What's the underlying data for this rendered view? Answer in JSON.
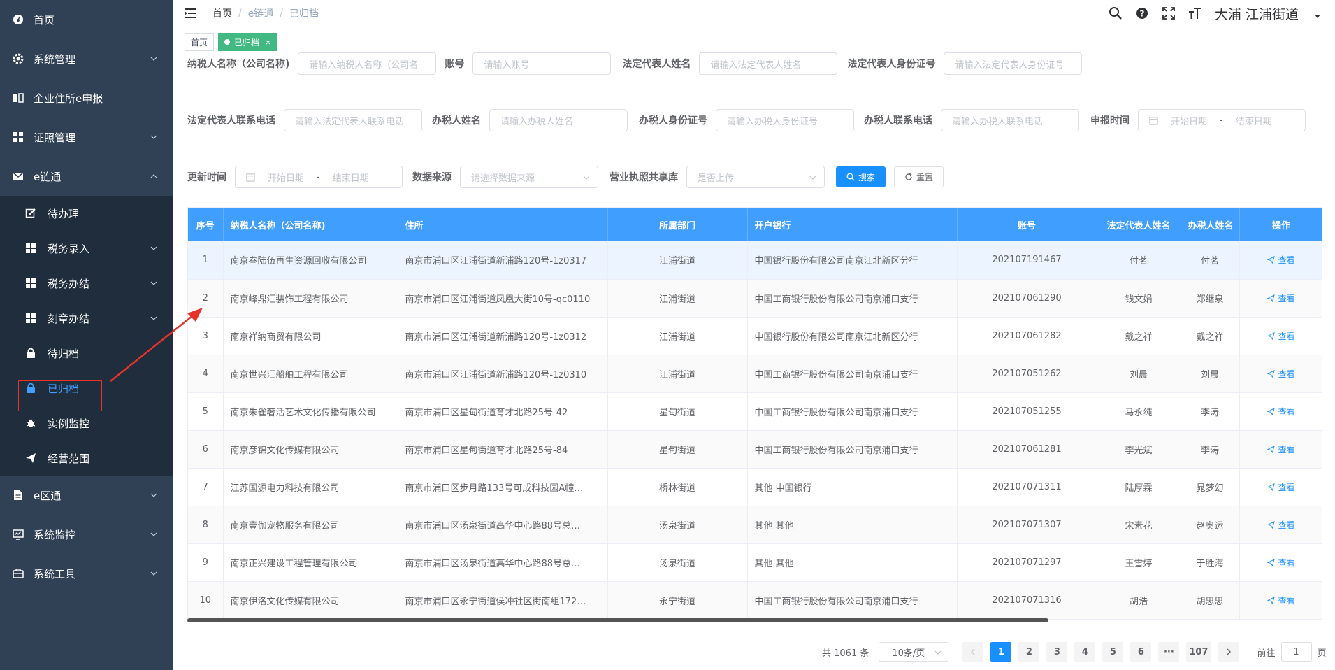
{
  "sidebar": {
    "items": [
      {
        "label": "首页",
        "icon": "dashboard-icon"
      },
      {
        "label": "系统管理",
        "icon": "gear-icon"
      },
      {
        "label": "企业住所e申报",
        "icon": "book-icon"
      },
      {
        "label": "证照管理",
        "icon": "grid-icon"
      },
      {
        "label": "e链通",
        "icon": "mail-icon"
      }
    ],
    "submenu": [
      {
        "label": "待办理",
        "icon": "edit-icon"
      },
      {
        "label": "税务录入",
        "icon": "grid-icon"
      },
      {
        "label": "税务办结",
        "icon": "grid-icon"
      },
      {
        "label": "刻章办结",
        "icon": "grid-icon"
      },
      {
        "label": "待归档",
        "icon": "lock-icon"
      },
      {
        "label": "已归档",
        "icon": "lock-icon"
      },
      {
        "label": "实例监控",
        "icon": "bug-icon"
      },
      {
        "label": "经营范围",
        "icon": "send-icon"
      }
    ],
    "bottom": [
      {
        "label": "e区通",
        "icon": "document-icon"
      },
      {
        "label": "系统监控",
        "icon": "monitor-icon"
      },
      {
        "label": "系统工具",
        "icon": "toolbox-icon"
      }
    ]
  },
  "navbar": {
    "breadcrumb": [
      "首页",
      "e链通",
      "已归档"
    ],
    "user": "大浦  江浦街道"
  },
  "tags": {
    "home": "首页",
    "current": "已归档",
    "close": "×"
  },
  "filters": {
    "taxpayer_name": {
      "label": "纳税人名称（公司名称)",
      "placeholder": "请输入纳税人名称（公司名"
    },
    "account": {
      "label": "账号",
      "placeholder": "请输入账号"
    },
    "legal_name": {
      "label": "法定代表人姓名",
      "placeholder": "请输入法定代表人姓名"
    },
    "legal_id": {
      "label": "法定代表人身份证号",
      "placeholder": "请输入法定代表人身份证号"
    },
    "legal_phone": {
      "label": "法定代表人联系电话",
      "placeholder": "请输入法定代表人联系电话"
    },
    "agent_name": {
      "label": "办税人姓名",
      "placeholder": "请输入办税人姓名"
    },
    "agent_id": {
      "label": "办税人身份证号",
      "placeholder": "请输入办税人身份证号"
    },
    "agent_phone": {
      "label": "办税人联系电话",
      "placeholder": "请输入办税人联系电话"
    },
    "apply_time": {
      "label": "申报时间",
      "start": "开始日期",
      "end": "结束日期",
      "sep": "-"
    },
    "update_time": {
      "label": "更新时间",
      "start": "开始日期",
      "end": "结束日期",
      "sep": "-"
    },
    "source": {
      "label": "数据来源",
      "placeholder": "请选择数据来源"
    },
    "license_share": {
      "label": "营业执照共享库",
      "placeholder": "是否上传"
    },
    "search_btn": "搜索",
    "reset_btn": "重置"
  },
  "table": {
    "headers": [
      "序号",
      "纳税人名称（公司名称)",
      "住所",
      "所属部门",
      "开户银行",
      "账号",
      "法定代表人姓名",
      "办税人姓名",
      "操作"
    ],
    "op_label": "查看",
    "rows": [
      [
        "1",
        "南京叁陆伍再生资源回收有限公司",
        "南京市浦口区江浦街道新浦路120号-1z0317",
        "江浦街道",
        "中国银行股份有限公司南京江北新区分行",
        "202107191467",
        "付茗",
        "付茗"
      ],
      [
        "2",
        "南京峰鼎汇装饰工程有限公司",
        "南京市浦口区江浦街道凤凰大街10号-qc0110",
        "江浦街道",
        "中国工商银行股份有限公司南京浦口支行",
        "202107061290",
        "钱文娟",
        "郑继泉"
      ],
      [
        "3",
        "南京祥纳商贸有限公司",
        "南京市浦口区江浦街道新浦路120号-1z0312",
        "江浦街道",
        "中国银行股份有限公司南京江北新区分行",
        "202107061282",
        "戴之祥",
        "戴之祥"
      ],
      [
        "4",
        "南京世兴汇船舶工程有限公司",
        "南京市浦口区江浦街道新浦路120号-1z0310",
        "江浦街道",
        "中国工商银行股份有限公司南京浦口支行",
        "202107051262",
        "刘晨",
        "刘晨"
      ],
      [
        "5",
        "南京朱雀奢活艺术文化传播有限公司",
        "南京市浦口区星甸街道育才北路25号-42",
        "星甸街道",
        "中国工商银行股份有限公司南京浦口支行",
        "202107051255",
        "马永纯",
        "李涛"
      ],
      [
        "6",
        "南京彦锦文化传媒有限公司",
        "南京市浦口区星甸街道育才北路25号-84",
        "星甸街道",
        "中国工商银行股份有限公司南京浦口支行",
        "202107061281",
        "李光斌",
        "李涛"
      ],
      [
        "7",
        "江苏国源电力科技有限公司",
        "南京市浦口区步月路133号可成科技园A幢…",
        "桥林街道",
        "其他  中国银行",
        "202107071311",
        "陆厚霖",
        "晁梦幻"
      ],
      [
        "8",
        "南京壹伽宠物服务有限公司",
        "南京市浦口区汤泉街道高华中心路88号总…",
        "汤泉街道",
        "其他  其他",
        "202107071307",
        "宋素花",
        "赵奥运"
      ],
      [
        "9",
        "南京正兴建设工程管理有限公司",
        "南京市浦口区汤泉街道高华中心路88号总…",
        "汤泉街道",
        "其他  其他",
        "202107071297",
        "王雪婷",
        "于胜海"
      ],
      [
        "10",
        "南京伊洛文化传媒有限公司",
        "南京市浦口区永宁街道侯冲社区街南组172…",
        "永宁街道",
        "中国工商银行股份有限公司南京浦口支行",
        "202107071316",
        "胡浩",
        "胡思思"
      ]
    ]
  },
  "pagination": {
    "total": "共 1061 条",
    "page_size": "10条/页",
    "pages": [
      "1",
      "2",
      "3",
      "4",
      "5",
      "6",
      "···",
      "107"
    ],
    "current": "1",
    "goto_label": "前往",
    "goto_value": "1",
    "goto_suffix": "页"
  },
  "colors": {
    "sidebar": "#304156",
    "submenu": "#1f2d3d",
    "primary": "#1890ff",
    "header": "#409eff",
    "tag_active": "#42b983",
    "annotation": "#e5332a"
  }
}
